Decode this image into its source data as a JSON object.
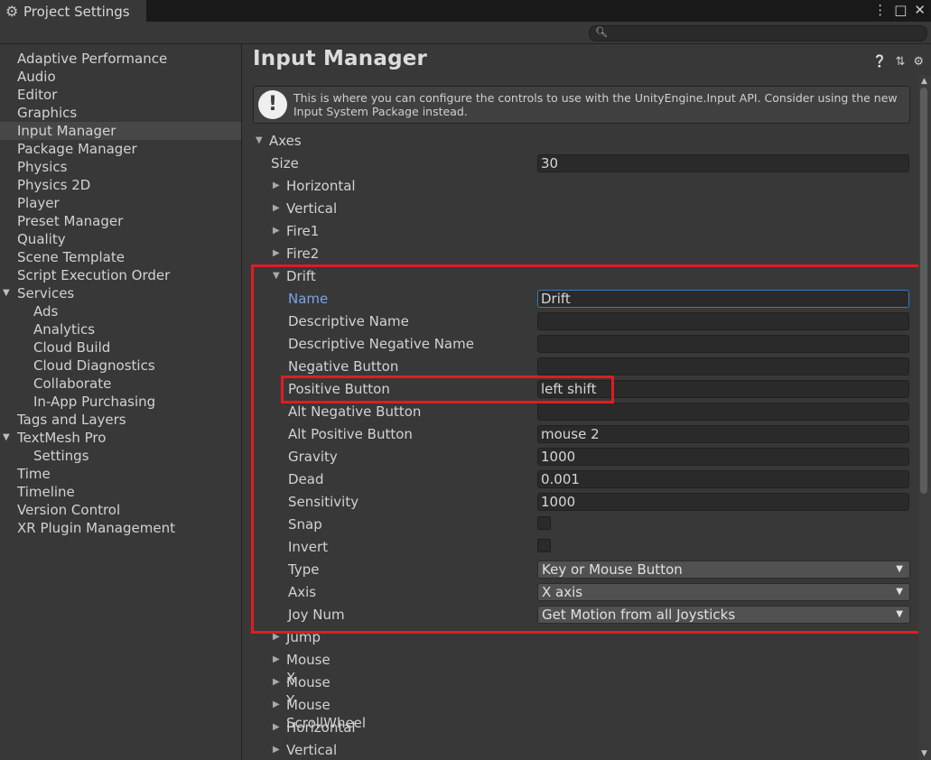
{
  "window": {
    "title": "Project Settings",
    "controls": [
      "⋮",
      "□",
      "✕"
    ]
  },
  "search": {
    "placeholder": ""
  },
  "nav": {
    "items": [
      {
        "label": "Adaptive Performance"
      },
      {
        "label": "Audio"
      },
      {
        "label": "Editor"
      },
      {
        "label": "Graphics"
      },
      {
        "label": "Input Manager",
        "selected": true
      },
      {
        "label": "Package Manager"
      },
      {
        "label": "Physics"
      },
      {
        "label": "Physics 2D"
      },
      {
        "label": "Player"
      },
      {
        "label": "Preset Manager"
      },
      {
        "label": "Quality"
      },
      {
        "label": "Scene Template"
      },
      {
        "label": "Script Execution Order"
      },
      {
        "label": "Services",
        "expanded": true
      },
      {
        "label": "Ads",
        "child": true
      },
      {
        "label": "Analytics",
        "child": true
      },
      {
        "label": "Cloud Build",
        "child": true
      },
      {
        "label": "Cloud Diagnostics",
        "child": true
      },
      {
        "label": "Collaborate",
        "child": true
      },
      {
        "label": "In-App Purchasing",
        "child": true
      },
      {
        "label": "Tags and Layers"
      },
      {
        "label": "TextMesh Pro",
        "expanded": true
      },
      {
        "label": "Settings",
        "child": true
      },
      {
        "label": "Time"
      },
      {
        "label": "Timeline"
      },
      {
        "label": "Version Control"
      },
      {
        "label": "XR Plugin Management"
      }
    ]
  },
  "main": {
    "title": "Input Manager",
    "info": "This is where you can configure the controls to use with the UnityEngine.Input API. Consider using the new Input System Package instead.",
    "axes_label": "Axes",
    "size_label": "Size",
    "size_value": "30",
    "collapsed_before": [
      "Horizontal",
      "Vertical",
      "Fire1",
      "Fire2"
    ],
    "drift": {
      "label": "Drift",
      "name_label": "Name",
      "name_value": "Drift",
      "desc_label": "Descriptive Name",
      "desc_value": "",
      "desc_neg_label": "Descriptive Negative Name",
      "desc_neg_value": "",
      "neg_btn_label": "Negative Button",
      "neg_btn_value": "",
      "pos_btn_label": "Positive Button",
      "pos_btn_value": "left shift",
      "alt_neg_label": "Alt Negative Button",
      "alt_neg_value": "",
      "alt_pos_label": "Alt Positive Button",
      "alt_pos_value": "mouse 2",
      "gravity_label": "Gravity",
      "gravity_value": "1000",
      "dead_label": "Dead",
      "dead_value": "0.001",
      "sens_label": "Sensitivity",
      "sens_value": "1000",
      "snap_label": "Snap",
      "snap_checked": false,
      "invert_label": "Invert",
      "invert_checked": false,
      "type_label": "Type",
      "type_value": "Key or Mouse Button",
      "axis_label": "Axis",
      "axis_value": "X axis",
      "joy_label": "Joy Num",
      "joy_value": "Get Motion from all Joysticks"
    },
    "collapsed_after": [
      "Jump",
      "Mouse X",
      "Mouse Y",
      "Mouse ScrollWheel",
      "Horizontal",
      "Vertical"
    ]
  }
}
